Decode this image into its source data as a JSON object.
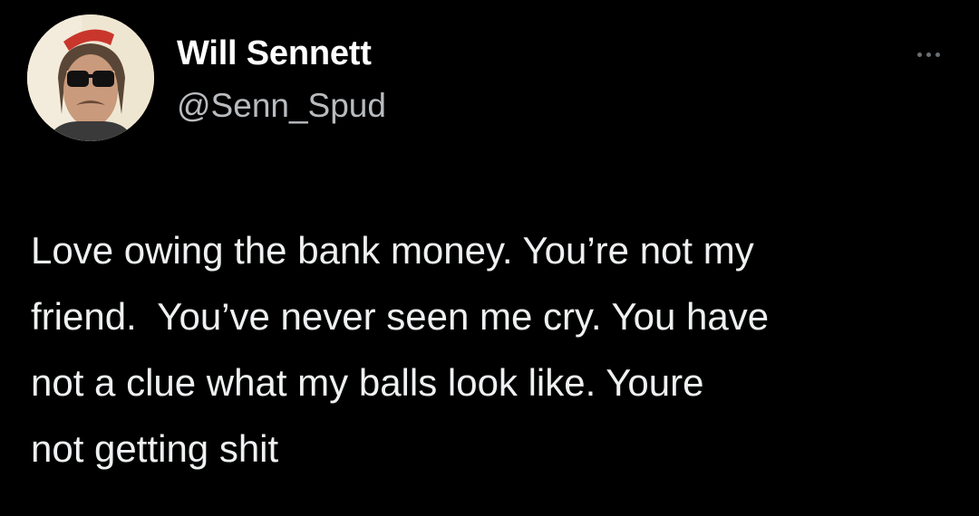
{
  "tweet": {
    "author": {
      "display_name": "Will Sennett",
      "handle": "@Senn_Spud",
      "avatar_icon": "profile-photo"
    },
    "more_icon": "ellipsis-icon",
    "text": "Love owing the bank money. You’re not my\nfriend.  You’ve never seen me cry. You have\nnot a clue what my balls look like. Youre\nnot getting shit"
  },
  "colors": {
    "background": "#000000",
    "name": "#ffffff",
    "handle": "#b9bcbf",
    "text": "#eef0f1"
  }
}
